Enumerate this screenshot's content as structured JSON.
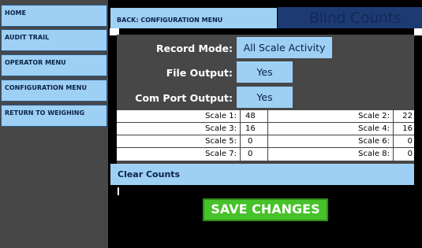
{
  "sidebar": {
    "items": [
      {
        "label": "HOME"
      },
      {
        "label": "AUDIT TRAIL"
      },
      {
        "label": "OPERATOR MENU"
      },
      {
        "label": "CONFIGURATION MENU"
      },
      {
        "label": "RETURN TO WEIGHING"
      }
    ]
  },
  "header": {
    "breadcrumb": "BACK: CONFIGURATION MENU",
    "title": "Blind Counts"
  },
  "settings": {
    "record_mode": {
      "label": "Record Mode:",
      "value": "All Scale Activity"
    },
    "file_output": {
      "label": "File Output:",
      "value": "Yes"
    },
    "com_port_output": {
      "label": "Com Port Output:",
      "value": "Yes"
    }
  },
  "scales": [
    {
      "label": "Scale 1:",
      "value": "48"
    },
    {
      "label": "Scale 2:",
      "value": "22"
    },
    {
      "label": "Scale 3:",
      "value": "16"
    },
    {
      "label": "Scale 4:",
      "value": "16"
    },
    {
      "label": "Scale 5:",
      "value": "0"
    },
    {
      "label": "Scale 6:",
      "value": "0"
    },
    {
      "label": "Scale 7:",
      "value": "0"
    },
    {
      "label": "Scale 8:",
      "value": "0"
    }
  ],
  "actions": {
    "clear_counts": "Clear Counts",
    "save_changes": "SAVE CHANGES"
  },
  "colors": {
    "button_blue": "#9ecff4",
    "title_navy": "#1d3a73",
    "save_green": "#47c22a",
    "panel_gray": "#474747"
  }
}
